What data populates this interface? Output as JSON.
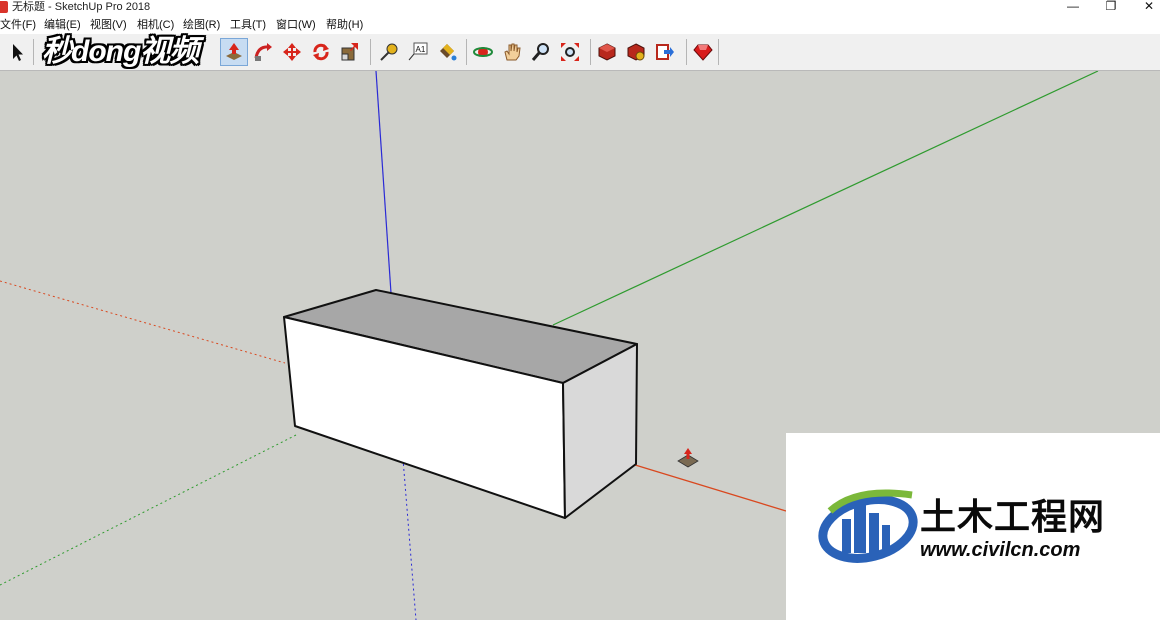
{
  "window": {
    "title": "无标题 - SketchUp Pro 2018",
    "minimize_glyph": "—",
    "restore_glyph": "❐",
    "close_glyph": "✕"
  },
  "menubar": {
    "items": [
      {
        "label": "文件(F)"
      },
      {
        "label": "编辑(E)"
      },
      {
        "label": "视图(V)"
      },
      {
        "label": "相机(C)"
      },
      {
        "label": "绘图(R)"
      },
      {
        "label": "工具(T)"
      },
      {
        "label": "窗口(W)"
      },
      {
        "label": "帮助(H)"
      }
    ]
  },
  "toolbar": {
    "tools": [
      {
        "icon": "select-arrow-icon",
        "active": false
      },
      {
        "icon": "push-pull-icon",
        "active": true
      },
      {
        "icon": "follow-me-icon",
        "active": false
      },
      {
        "icon": "move-icon",
        "active": false
      },
      {
        "icon": "rotate-icon",
        "active": false
      },
      {
        "icon": "scale-icon",
        "active": false
      },
      {
        "icon": "tape-measure-icon",
        "active": false
      },
      {
        "icon": "text-label-icon",
        "active": false
      },
      {
        "icon": "paint-bucket-icon",
        "active": false
      },
      {
        "icon": "orbit-icon",
        "active": false
      },
      {
        "icon": "pan-icon",
        "active": false
      },
      {
        "icon": "zoom-icon",
        "active": false
      },
      {
        "icon": "zoom-extents-icon",
        "active": false
      },
      {
        "icon": "3d-warehouse-icon",
        "active": false
      },
      {
        "icon": "extension-warehouse-icon",
        "active": false
      },
      {
        "icon": "send-to-layout-icon",
        "active": false
      },
      {
        "icon": "ruby-console-icon",
        "active": false
      }
    ],
    "text_tool_glyph": "A1"
  },
  "watermark": {
    "text": "秒dong视频"
  },
  "colors": {
    "canvas_bg": "#cfd0cb",
    "red_axis": "#d9481f",
    "green_axis": "#2f9b2f",
    "blue_axis": "#2a2ad6",
    "box_top": "#a7a7a7",
    "box_front": "#ffffff",
    "box_side": "#d9d9d9"
  },
  "logo": {
    "title": "土木工程网",
    "url": "www.civilcn.com"
  }
}
